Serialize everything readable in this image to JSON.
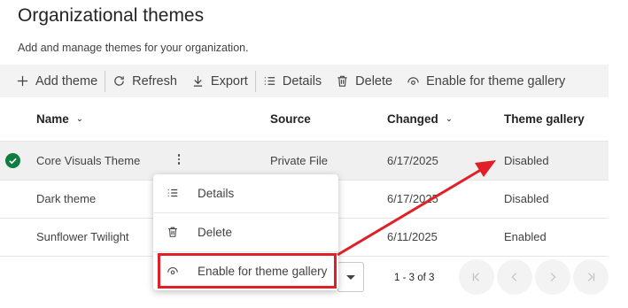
{
  "page": {
    "title": "Organizational themes",
    "subtitle": "Add and manage themes for your organization."
  },
  "toolbar": {
    "add_theme": "Add theme",
    "refresh": "Refresh",
    "export": "Export",
    "details": "Details",
    "delete": "Delete",
    "enable_gallery": "Enable for theme gallery"
  },
  "table": {
    "columns": {
      "name": "Name",
      "source": "Source",
      "changed": "Changed",
      "gallery": "Theme gallery"
    },
    "rows": [
      {
        "name": "Core Visuals Theme",
        "source": "Private File",
        "changed": "6/17/2025",
        "gallery": "Disabled",
        "selected": true
      },
      {
        "name": "Dark theme",
        "source": "",
        "changed": "6/17/2025",
        "gallery": "Disabled",
        "selected": false
      },
      {
        "name": "Sunflower Twilight",
        "source": "",
        "changed": "6/11/2025",
        "gallery": "Enabled",
        "selected": false
      }
    ]
  },
  "context_menu": {
    "items": [
      {
        "label": "Details",
        "icon": "list-icon"
      },
      {
        "label": "Delete",
        "icon": "trash-icon"
      },
      {
        "label": "Enable for theme gallery",
        "icon": "eye-icon",
        "highlighted": true
      }
    ]
  },
  "pager": {
    "range": "1 - 3 of 3"
  },
  "colors": {
    "check": "#107c41",
    "highlight": "#e02027",
    "selected_row": "#f0f0f0"
  }
}
